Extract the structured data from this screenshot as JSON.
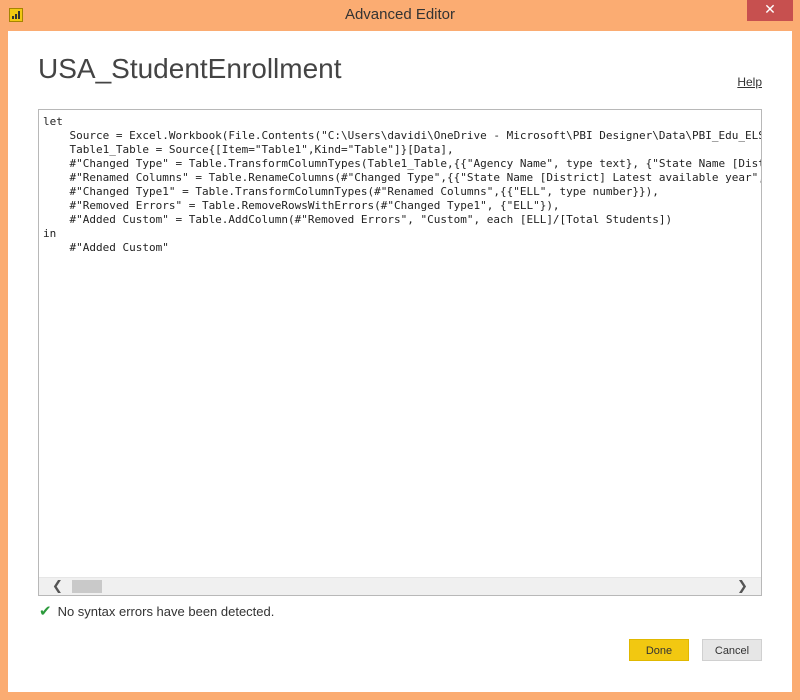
{
  "window": {
    "title": "Advanced Editor",
    "close_label": "✕",
    "accent_color": "#fbac72"
  },
  "query": {
    "name": "USA_StudentEnrollment"
  },
  "help_label": "Help",
  "editor": {
    "code": "let\n    Source = Excel.Workbook(File.Contents(\"C:\\Users\\davidi\\OneDrive - Microsoft\\PBI Designer\\Data\\PBI_Edu_ELS\n    Table1_Table = Source{[Item=\"Table1\",Kind=\"Table\"]}[Data],\n    #\"Changed Type\" = Table.TransformColumnTypes(Table1_Table,{{\"Agency Name\", type text}, {\"State Name [Dist\n    #\"Renamed Columns\" = Table.RenameColumns(#\"Changed Type\",{{\"State Name [District] Latest available year\",\n    #\"Changed Type1\" = Table.TransformColumnTypes(#\"Renamed Columns\",{{\"ELL\", type number}}),\n    #\"Removed Errors\" = Table.RemoveRowsWithErrors(#\"Changed Type1\", {\"ELL\"}),\n    #\"Added Custom\" = Table.AddColumn(#\"Removed Errors\", \"Custom\", each [ELL]/[Total Students])\nin\n    #\"Added Custom\"",
    "scroll_left": "❮",
    "scroll_right": "❯"
  },
  "status": {
    "icon": "check-icon",
    "text": "No syntax errors have been detected."
  },
  "buttons": {
    "done": "Done",
    "cancel": "Cancel",
    "done_color": "#f2c811"
  }
}
